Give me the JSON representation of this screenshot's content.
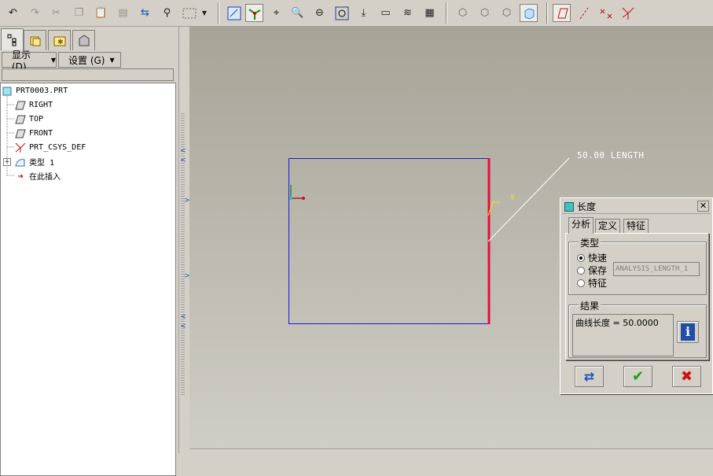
{
  "toolbar": {
    "icons": [
      "undo-icon",
      "redo-icon",
      "cut-icon",
      "copy-icon",
      "paste-icon",
      "paste-special-icon",
      "regenerate-icon",
      "find-icon",
      "select-box-icon",
      "repaint-icon",
      "spin-center-icon",
      "orient-icon",
      "zoom-in-icon",
      "zoom-out-icon",
      "refit-icon",
      "reorient-icon",
      "named-view-icon",
      "layers-icon",
      "model-setup-icon",
      "wireframe-icon",
      "hidden-line-icon",
      "no-hidden-icon",
      "shading-icon",
      "datum-planes-icon",
      "datum-axes-icon",
      "datum-points-icon",
      "coordinate-systems-icon"
    ]
  },
  "left_panel": {
    "tabs": [
      "model-tree-tab",
      "layer-tree-tab",
      "favorites-tab",
      "connections-tab"
    ],
    "show_menu": "显示 (D)",
    "settings_menu": "设置 (G)",
    "tree": [
      {
        "label": "PRT0003.PRT",
        "icon": "part-icon"
      },
      {
        "label": "RIGHT",
        "icon": "datum-plane-icon"
      },
      {
        "label": "TOP",
        "icon": "datum-plane-icon"
      },
      {
        "label": "FRONT",
        "icon": "datum-plane-icon"
      },
      {
        "label": "PRT_CSYS_DEF",
        "icon": "csys-icon"
      },
      {
        "label": "类型 1",
        "icon": "analysis-icon"
      },
      {
        "label": "在此插入",
        "icon": "insert-arrow-icon"
      }
    ]
  },
  "canvas": {
    "length_annotation": "50.00 LENGTH",
    "colors": {
      "sketch": "#1a1ad8",
      "selected_edge": "#e0103a",
      "leader": "#ffffff",
      "marker": "#ffee00"
    }
  },
  "dialog": {
    "title": "长度",
    "tabs": [
      "分析",
      "定义",
      "特征"
    ],
    "type_group": "类型",
    "options": [
      "快速",
      "保存",
      "特征"
    ],
    "selected_option": "快速",
    "save_name": "ANALYSIS_LENGTH_1",
    "result_group": "结果",
    "result_text": "曲线长度 = 50.0000"
  }
}
